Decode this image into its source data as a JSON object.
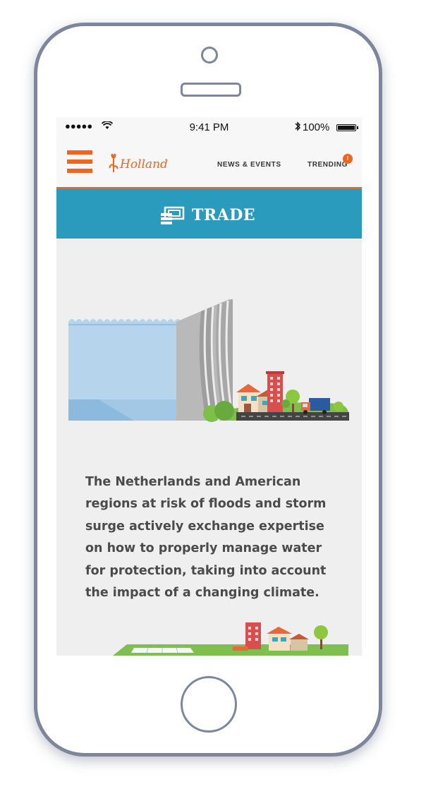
{
  "status_bar": {
    "signal": "●●●●●",
    "time": "9:41 PM",
    "battery": "100%"
  },
  "nav": {
    "logo_text": "Holland",
    "news_events": "NEWS & EVENTS",
    "trending": "TRENDING",
    "trending_badge": "!"
  },
  "section": {
    "title": "TRADE",
    "icon": "money-icon"
  },
  "content": {
    "paragraph": "The Netherlands and American regions at risk of floods and storm surge actively exchange expertise on how to properly manage water for protection, taking into account the impact of a changing climate."
  },
  "colors": {
    "accent_orange": "#f0641e",
    "header_blue": "#2a9bbd",
    "screen_bg": "#efefef"
  }
}
